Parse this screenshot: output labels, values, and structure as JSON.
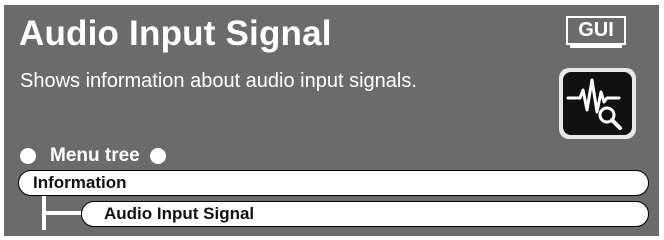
{
  "page": {
    "title": "Audio Input Signal",
    "description": "Shows information about audio input signals.",
    "gui_badge": "GUI",
    "icon": "audio-waveform-magnifier-icon"
  },
  "menu_tree": {
    "label": "Menu tree",
    "items": [
      {
        "label": "Information",
        "level": 0
      },
      {
        "label": "Audio Input Signal",
        "level": 1
      }
    ]
  },
  "colors": {
    "panel": "#6b6b6b",
    "text": "#ffffff",
    "pill": "#ffffff"
  }
}
